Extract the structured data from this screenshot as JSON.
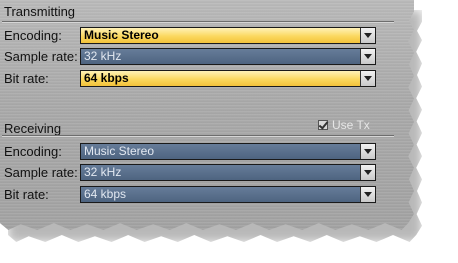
{
  "transmitting": {
    "title": "Transmitting",
    "encoding": {
      "label": "Encoding:",
      "value": "Music Stereo"
    },
    "sample_rate": {
      "label": "Sample rate:",
      "value": "32 kHz"
    },
    "bit_rate": {
      "label": "Bit rate:",
      "value": "64 kbps"
    }
  },
  "receiving": {
    "title": "Receiving",
    "use_tx": {
      "label": "Use Tx",
      "checked": true
    },
    "encoding": {
      "label": "Encoding:",
      "value": "Music Stereo"
    },
    "sample_rate": {
      "label": "Sample rate:",
      "value": "32 kHz"
    },
    "bit_rate": {
      "label": "Bit rate:",
      "value": "64 kbps"
    }
  },
  "colors": {
    "active_select": "#fbd85f",
    "inactive_select": "#52678a",
    "panel": "#aaaaaa"
  }
}
